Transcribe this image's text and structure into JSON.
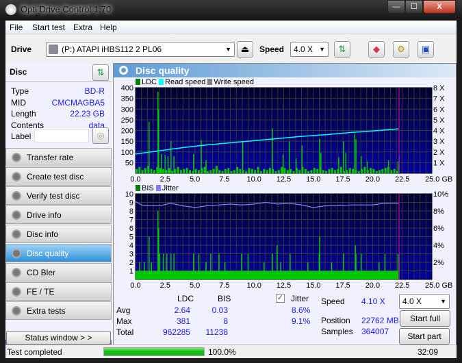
{
  "window": {
    "title": "Opti Drive Control 1.70",
    "minimize": "—",
    "maximize": "☐",
    "close": "X"
  },
  "menu": [
    "File",
    "Start test",
    "Extra",
    "Help"
  ],
  "toolbar": {
    "drive_label": "Drive",
    "drive_value": "(P:)   ATAPI iHBS112   2 PL06",
    "speed_label": "Speed",
    "speed_value": "4.0 X"
  },
  "disc": {
    "header": "Disc",
    "rows": [
      {
        "k": "Type",
        "v": "BD-R"
      },
      {
        "k": "MID",
        "v": "CMCMAGBA5"
      },
      {
        "k": "Length",
        "v": "22.23 GB"
      },
      {
        "k": "Contents",
        "v": "data"
      }
    ],
    "label_key": "Label",
    "label_value": ""
  },
  "nav": [
    {
      "label": "Transfer rate"
    },
    {
      "label": "Create test disc"
    },
    {
      "label": "Verify test disc"
    },
    {
      "label": "Drive info"
    },
    {
      "label": "Disc info"
    },
    {
      "label": "Disc quality",
      "active": true
    },
    {
      "label": "CD Bler"
    },
    {
      "label": "FE / TE"
    },
    {
      "label": "Extra tests"
    }
  ],
  "status_window": "Status window > >",
  "panel_title": "Disc quality",
  "colors": {
    "ldc": "#00c800",
    "read_speed": "#00ffff",
    "write_speed": "#808080",
    "bis": "#00c800",
    "jitter": "#8080ff",
    "plot_bg": "#000080",
    "marker": "#a000a0"
  },
  "chart_data": [
    {
      "type": "bar",
      "legend": [
        "LDC",
        "Read speed",
        "Write speed"
      ],
      "xlim": [
        0,
        25
      ],
      "ylim": [
        0,
        400
      ],
      "y2lim": [
        0,
        8
      ],
      "xticks": [
        "0.0",
        "2.5",
        "5.0",
        "7.5",
        "10.0",
        "12.5",
        "15.0",
        "17.5",
        "20.0",
        "22.5",
        "25.0 GB"
      ],
      "yticks": [
        "50",
        "100",
        "150",
        "200",
        "250",
        "300",
        "350",
        "400"
      ],
      "y2ticks": [
        "1 X",
        "2 X",
        "3 X",
        "4 X",
        "5 X",
        "6 X",
        "7 X",
        "8 X"
      ],
      "end_marker": 22.23,
      "ldc_spikes": [
        [
          1.1,
          240
        ],
        [
          1.85,
          381
        ],
        [
          1.9,
          300
        ],
        [
          2.15,
          90
        ],
        [
          2.45,
          85
        ],
        [
          2.7,
          80
        ],
        [
          2.95,
          150
        ],
        [
          3.2,
          80
        ],
        [
          4.85,
          90
        ],
        [
          5.5,
          155
        ],
        [
          5.9,
          60
        ],
        [
          9.0,
          150
        ],
        [
          11.5,
          210
        ],
        [
          12.4,
          85
        ],
        [
          12.95,
          150
        ],
        [
          13.5,
          70
        ],
        [
          14.0,
          130
        ],
        [
          15.5,
          160
        ],
        [
          15.6,
          95
        ],
        [
          17.1,
          75
        ],
        [
          17.5,
          150
        ],
        [
          17.7,
          95
        ],
        [
          18.45,
          185
        ],
        [
          18.55,
          160
        ],
        [
          19.0,
          80
        ],
        [
          19.5,
          55
        ],
        [
          21.3,
          60
        ],
        [
          22.1,
          55
        ],
        [
          22.2,
          80
        ]
      ],
      "ldc_base": [
        20,
        30,
        15,
        25,
        35,
        20,
        15,
        30,
        25,
        20,
        15,
        25,
        10,
        20,
        30,
        15,
        20,
        25,
        15,
        10,
        20,
        15,
        25,
        30,
        10,
        15,
        20,
        35,
        15,
        10,
        20,
        25,
        10,
        15,
        30,
        20,
        15,
        10,
        25,
        20,
        15,
        30,
        10,
        20,
        15,
        25,
        20,
        10,
        15,
        30,
        25,
        15,
        20,
        10,
        25,
        15,
        30,
        20,
        10,
        15,
        25,
        20,
        30,
        15,
        10,
        20,
        25,
        15,
        20,
        30,
        10,
        15,
        25,
        20,
        15,
        10,
        20,
        30,
        15,
        25,
        20,
        10,
        15,
        20,
        25,
        30,
        15,
        20,
        10
      ],
      "read_speed": [
        [
          0,
          1.8
        ],
        [
          2,
          2.1
        ],
        [
          4,
          2.4
        ],
        [
          6,
          2.65
        ],
        [
          8,
          2.85
        ],
        [
          10,
          3.05
        ],
        [
          12,
          3.25
        ],
        [
          14,
          3.45
        ],
        [
          16,
          3.6
        ],
        [
          18,
          3.8
        ],
        [
          20,
          3.95
        ],
        [
          22.2,
          4.15
        ]
      ]
    },
    {
      "type": "bar",
      "legend": [
        "BIS",
        "Jitter"
      ],
      "xlim": [
        0,
        25
      ],
      "ylim": [
        0,
        10
      ],
      "y2lim": [
        0,
        10
      ],
      "xticks": [
        "0.0",
        "2.5",
        "5.0",
        "7.5",
        "10.0",
        "12.5",
        "15.0",
        "17.5",
        "20.0",
        "22.5",
        "25.0 GB"
      ],
      "yticks": [
        "1",
        "2",
        "3",
        "4",
        "5",
        "6",
        "7",
        "8",
        "9",
        "10"
      ],
      "y2ticks": [
        "2%",
        "4%",
        "6%",
        "8%",
        "10%"
      ],
      "end_marker": 22.23,
      "bis_base": 1,
      "bis_spikes": [
        [
          0.3,
          2
        ],
        [
          0.7,
          2
        ],
        [
          1.1,
          5
        ],
        [
          1.3,
          2
        ],
        [
          1.85,
          8
        ],
        [
          1.9,
          6
        ],
        [
          2.0,
          3
        ],
        [
          2.3,
          3
        ],
        [
          2.6,
          3
        ],
        [
          2.95,
          3
        ],
        [
          3.2,
          3
        ],
        [
          4.85,
          3
        ],
        [
          5.3,
          3
        ],
        [
          6.3,
          3
        ],
        [
          7.0,
          3
        ],
        [
          8.9,
          3
        ],
        [
          9.45,
          3
        ],
        [
          11.5,
          3
        ],
        [
          11.9,
          4
        ],
        [
          13.0,
          3
        ],
        [
          14.5,
          2
        ],
        [
          15.5,
          5
        ],
        [
          15.45,
          3
        ],
        [
          17.5,
          3
        ],
        [
          18.5,
          4
        ],
        [
          18.55,
          3
        ],
        [
          19.0,
          3
        ],
        [
          21.0,
          3
        ],
        [
          22.1,
          3
        ],
        [
          22.2,
          3
        ],
        [
          5.9,
          2
        ],
        [
          7.5,
          2
        ],
        [
          10.8,
          2
        ],
        [
          12.2,
          2
        ],
        [
          16.5,
          2
        ],
        [
          20.5,
          2
        ]
      ],
      "jitter": [
        [
          0,
          9.1
        ],
        [
          0.5,
          8.7
        ],
        [
          1,
          8.6
        ],
        [
          2,
          8.6
        ],
        [
          3,
          8.9
        ],
        [
          4,
          8.6
        ],
        [
          5,
          8.4
        ],
        [
          6,
          8.6
        ],
        [
          7,
          8.7
        ],
        [
          8,
          8.8
        ],
        [
          9,
          8.7
        ],
        [
          10,
          8.8
        ],
        [
          11,
          9.0
        ],
        [
          12,
          8.8
        ],
        [
          13,
          8.9
        ],
        [
          14,
          8.7
        ],
        [
          15,
          8.4
        ],
        [
          16,
          8.6
        ],
        [
          17,
          8.6
        ],
        [
          18,
          8.7
        ],
        [
          19,
          8.7
        ],
        [
          20,
          8.7
        ],
        [
          21,
          8.9
        ],
        [
          22.2,
          8.9
        ]
      ]
    }
  ],
  "stats": {
    "col_ldc": "LDC",
    "col_bis": "BIS",
    "rows": [
      {
        "k": "Avg",
        "ldc": "2.64",
        "bis": "0.03",
        "jit": "8.6%"
      },
      {
        "k": "Max",
        "ldc": "381",
        "bis": "8",
        "jit": "9.1%"
      },
      {
        "k": "Total",
        "ldc": "962285",
        "bis": "11238"
      }
    ],
    "jitter_label": "Jitter",
    "jitter_checked": true,
    "speed_label": "Speed",
    "speed_value": "4.10 X",
    "position_label": "Position",
    "position_value": "22762 MB",
    "samples_label": "Samples",
    "samples_value": "364007",
    "speed_select": "4.0 X",
    "start_full": "Start full",
    "start_part": "Start part"
  },
  "status": {
    "text": "Test completed",
    "progress": 100.0,
    "progress_text": "100.0%",
    "time": "32:09"
  }
}
